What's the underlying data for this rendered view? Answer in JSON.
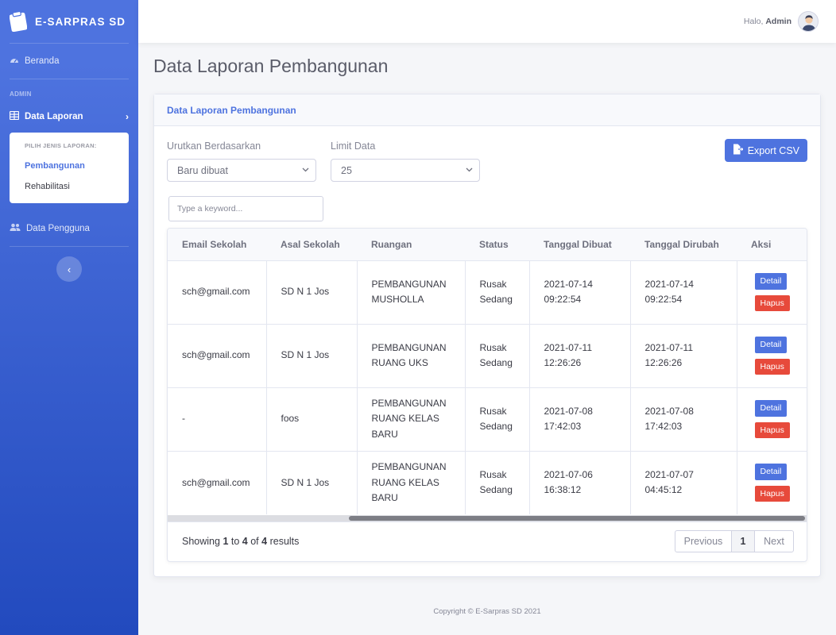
{
  "sidebar": {
    "brand": "E-SARPRAS SD",
    "beranda": "Beranda",
    "heading_admin": "ADMIN",
    "data_laporan": "Data Laporan",
    "collapse_header": "PILIH JENIS LAPORAN:",
    "pembangunan": "Pembangunan",
    "rehabilitasi": "Rehabilitasi",
    "data_pengguna": "Data Pengguna",
    "toggle_icon": "chevron-left-icon"
  },
  "topbar": {
    "greeting_prefix": "Halo,",
    "user_name": "Admin"
  },
  "page": {
    "title": "Data Laporan Pembangunan"
  },
  "card": {
    "header": "Data Laporan Pembangunan",
    "sort_label": "Urutkan Berdasarkan",
    "sort_value": "Baru dibuat",
    "limit_label": "Limit Data",
    "limit_value": "25",
    "export_label": "Export CSV",
    "search_placeholder": "Type a keyword..."
  },
  "table": {
    "headers": [
      "Email Sekolah",
      "Asal Sekolah",
      "Ruangan",
      "Status",
      "Tanggal Dibuat",
      "Tanggal Dirubah",
      "Aksi"
    ],
    "rows": [
      {
        "email": "sch@gmail.com",
        "asal": "SD N 1 Jos",
        "ruangan": "PEMBANGUNAN MUSHOLLA",
        "status": "Rusak Sedang",
        "dibuat": "2021-07-14 09:22:54",
        "dirubah": "2021-07-14 09:22:54"
      },
      {
        "email": "sch@gmail.com",
        "asal": "SD N 1 Jos",
        "ruangan": "PEMBANGUNAN RUANG UKS",
        "status": "Rusak Sedang",
        "dibuat": "2021-07-11 12:26:26",
        "dirubah": "2021-07-11 12:26:26"
      },
      {
        "email": "-",
        "asal": "foos",
        "ruangan": "PEMBANGUNAN RUANG KELAS BARU",
        "status": "Rusak Sedang",
        "dibuat": "2021-07-08 17:42:03",
        "dirubah": "2021-07-08 17:42:03"
      },
      {
        "email": "sch@gmail.com",
        "asal": "SD N 1 Jos",
        "ruangan": "PEMBANGUNAN RUANG KELAS BARU",
        "status": "Rusak Sedang",
        "dibuat": "2021-07-06 16:38:12",
        "dirubah": "2021-07-07 04:45:12"
      }
    ],
    "detail_label": "Detail",
    "hapus_label": "Hapus"
  },
  "pagination": {
    "showing_prefix": "Showing",
    "from": "1",
    "to_word": "to",
    "to": "4",
    "of_word": "of",
    "total": "4",
    "suffix": "results",
    "previous": "Previous",
    "current": "1",
    "next": "Next"
  },
  "footer": {
    "copyright": "Copyright © E-Sarpras SD 2021"
  },
  "colors": {
    "primary": "#4e73df",
    "danger": "#e74a3b",
    "sidebar_gradient_end": "#224abe"
  }
}
